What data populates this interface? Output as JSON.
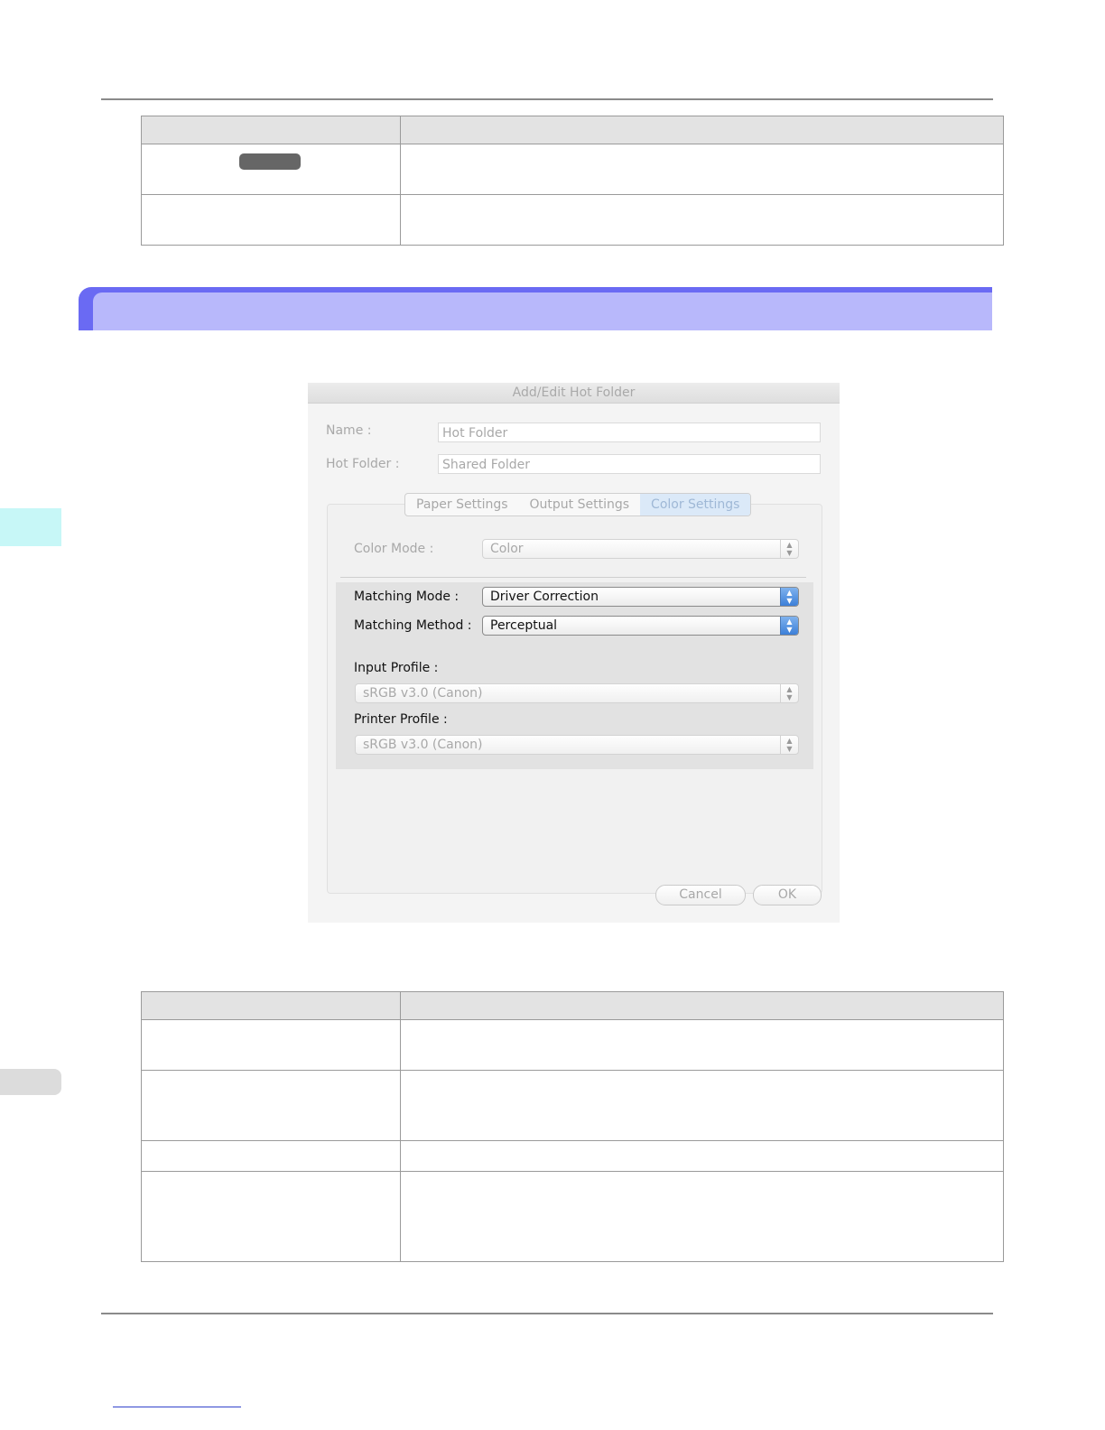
{
  "dialog": {
    "title": "Add/Edit Hot Folder",
    "name_label": "Name :",
    "name_value": "Hot Folder",
    "hot_folder_label": "Hot Folder :",
    "hot_folder_value": "Shared Folder",
    "tabs": [
      "Paper Settings",
      "Output Settings",
      "Color Settings"
    ],
    "active_tab": "Color Settings",
    "color_mode_label": "Color Mode :",
    "color_mode_value": "Color",
    "matching_mode_label": "Matching Mode :",
    "matching_mode_value": "Driver Correction",
    "matching_method_label": "Matching Method :",
    "matching_method_value": "Perceptual",
    "input_profile_label": "Input Profile :",
    "input_profile_value": "sRGB v3.0 (Canon)",
    "printer_profile_label": "Printer Profile :",
    "printer_profile_value": "sRGB v3.0 (Canon)",
    "cancel_label": "Cancel",
    "ok_label": "OK"
  },
  "colors": {
    "banner_dark": "#6a6af3",
    "banner_light": "#b8b8fb",
    "side_tab": "#c7f7f7",
    "select_accent": "#3c7fd8"
  }
}
